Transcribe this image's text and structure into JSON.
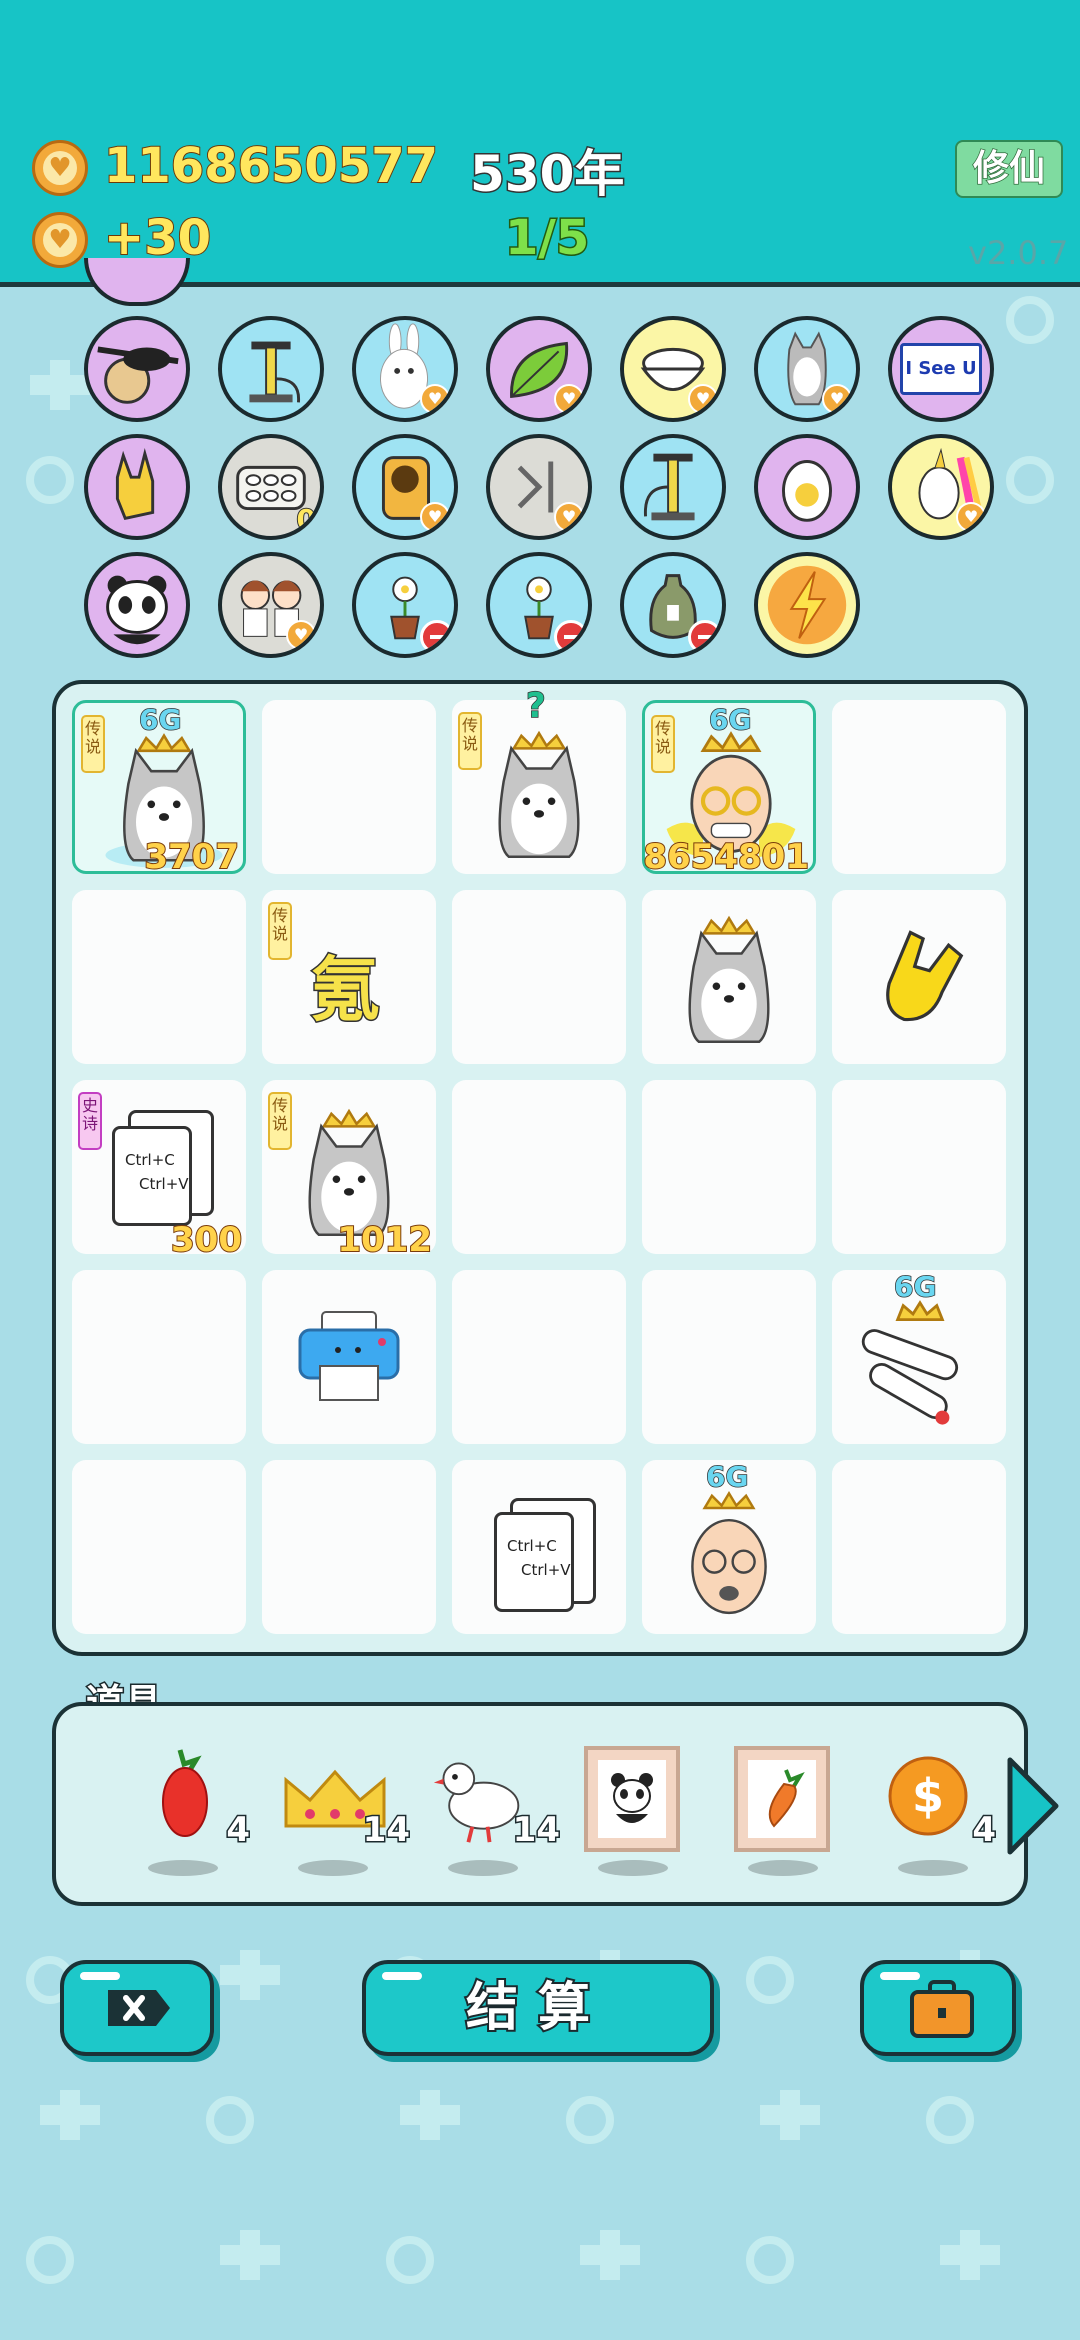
{
  "header": {
    "coins": "1168650577",
    "income": "+30",
    "year": "530年",
    "stage": "1/5",
    "cultivate_label": "修仙",
    "version": "v2.0.7"
  },
  "relics": {
    "row1": [
      "eyepatch-ball",
      "air-pump",
      "rabbit",
      "leaf",
      "rice-bowl",
      "husky",
      "i-see-u-sign"
    ],
    "row2": [
      "rock-hand",
      "egg-tray",
      "hamster",
      "skip-sign",
      "air-pump",
      "cracked-egg",
      "unicorn"
    ],
    "row3": [
      "panda",
      "twins",
      "flower-pot",
      "flower-pot",
      "trash-bag",
      "lightning"
    ],
    "i_see_u_text": "I See U",
    "egg_tray_count": "0"
  },
  "board": {
    "legend_tag": "传说",
    "epic_tag": "史诗",
    "six_g": "6G",
    "question": "?",
    "krypton": "氪",
    "ctrl_c": "Ctrl+C",
    "ctrl_v": "Ctrl+V",
    "values": {
      "husky_king_1": "3707",
      "old_man_king": "8654801",
      "copy_paste": "300",
      "husky_king_2": "1012"
    }
  },
  "tools": {
    "title": "道具",
    "items": [
      {
        "icon": "chili-icon",
        "count": "4"
      },
      {
        "icon": "crown-icon",
        "count": "14"
      },
      {
        "icon": "pigeon-icon",
        "count": "14"
      },
      {
        "icon": "panda-frame-icon",
        "count": ""
      },
      {
        "icon": "carrot-frame-icon",
        "count": ""
      },
      {
        "icon": "coin-dollar-icon",
        "count": "4"
      }
    ]
  },
  "buttons": {
    "settle_label": "结算"
  },
  "colors": {
    "header": "#17c4c6",
    "background": "#a9dde7",
    "board": "#d9f2f2",
    "highlight": "#2dbd98"
  }
}
